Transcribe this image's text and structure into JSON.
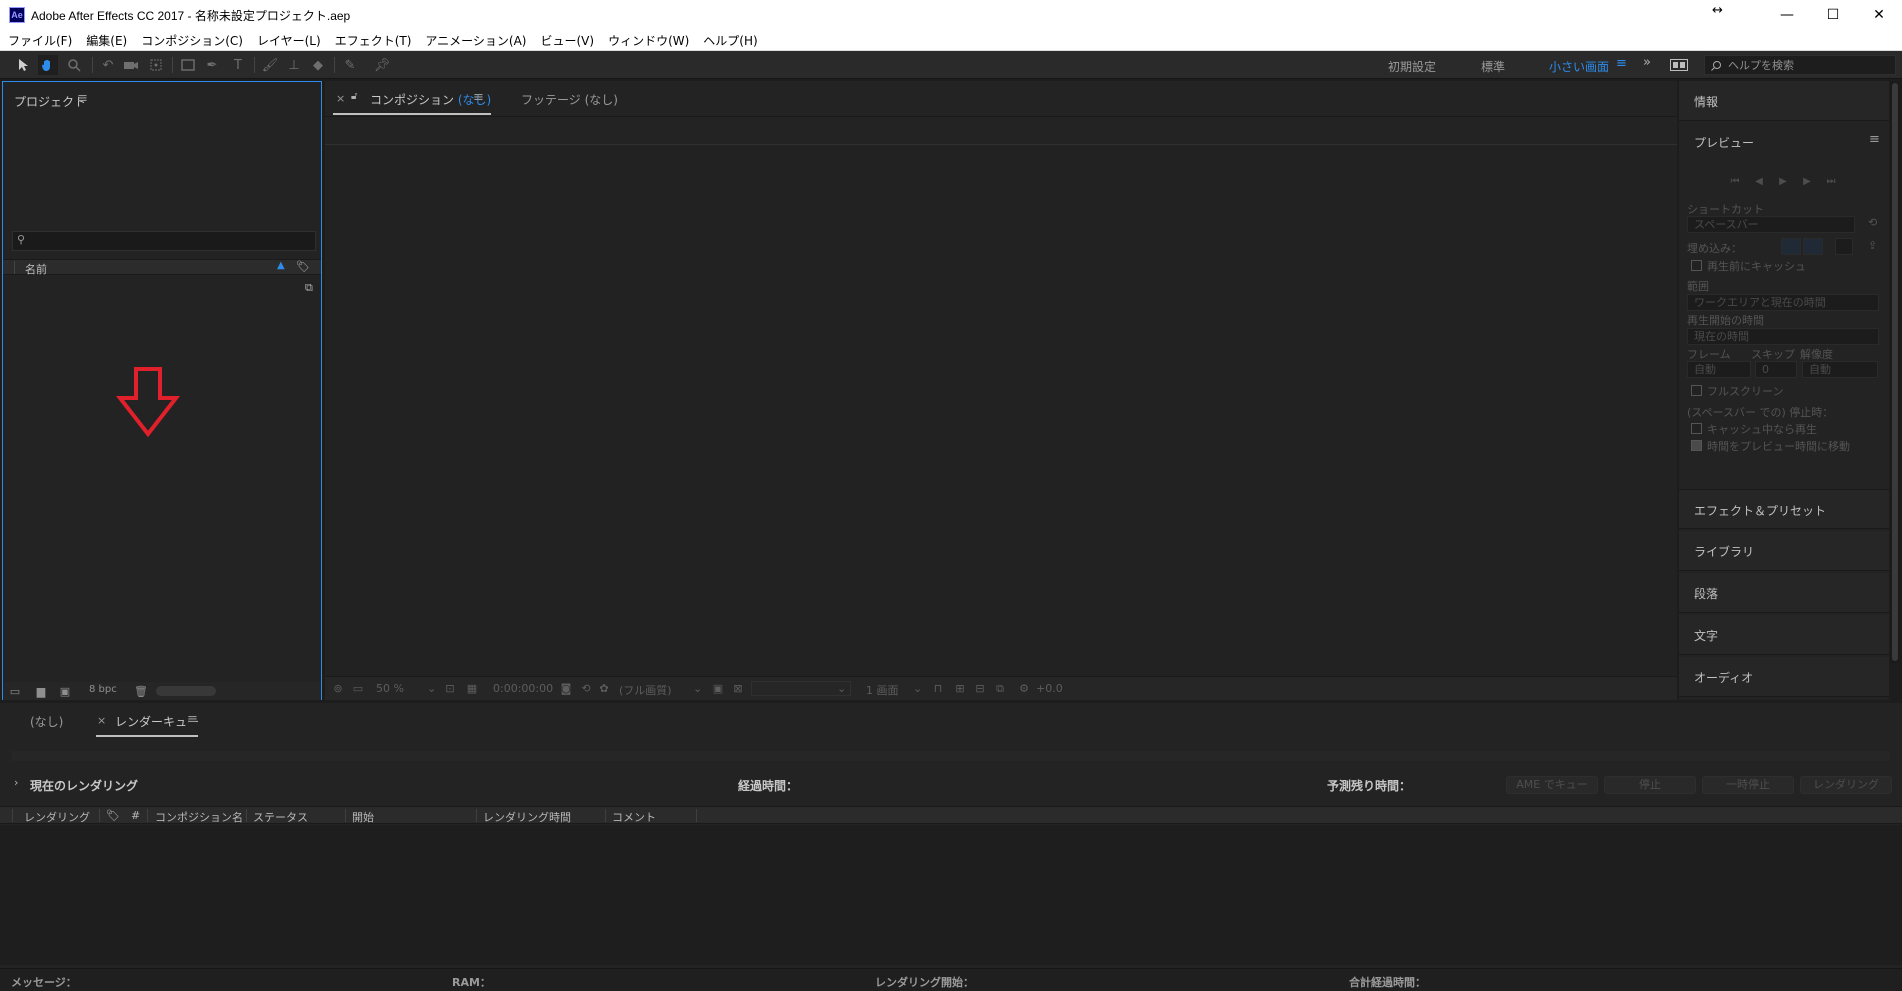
{
  "window": {
    "app_icon": "Ae",
    "title": "Adobe After Effects CC 2017 - 名称未設定プロジェクト.aep",
    "resize_glyph": "↔",
    "minimize": "—",
    "maximize": "☐",
    "close": "✕"
  },
  "menu": [
    "ファイル(F)",
    "編集(E)",
    "コンポジション(C)",
    "レイヤー(L)",
    "エフェクト(T)",
    "アニメーション(A)",
    "ビュー(V)",
    "ウィンドウ(W)",
    "ヘルプ(H)"
  ],
  "toolbar": {
    "workspaces": [
      "初期設定",
      "標準",
      "小さい画面"
    ],
    "active_workspace": "小さい画面",
    "help_search_placeholder": "ヘルプを検索"
  },
  "project": {
    "title": "プロジェクト",
    "column_name": "名前",
    "bpc": "8 bpc"
  },
  "composition": {
    "tab_prefix": "コンポジション",
    "tab_name": "(なし)",
    "footage_tab": "フッテージ (なし)",
    "zoom": "50 %",
    "timecode": "0:00:00:00",
    "resolution": "(フル画質)",
    "view_count": "1 画面",
    "exposure": "+0.0"
  },
  "right_panel": {
    "info": "情報",
    "preview": "プレビュー",
    "shortcut_label": "ショートカット",
    "shortcut_value": "スペースバー",
    "include_label": "埋め込み：",
    "cache_before": "再生前にキャッシュ",
    "range_label": "範囲",
    "range_value": "ワークエリアと現在の時間",
    "start_label": "再生開始の時間",
    "start_value": "現在の時間",
    "frame_label": "フレーム",
    "skip_label": "スキップ",
    "resolution_label": "解像度",
    "frame_value": "自動",
    "skip_value": "0",
    "resolution_value": "自動",
    "fullscreen": "フルスクリーン",
    "stop_label": "(スペースバー での) 停止時：",
    "if_caching": "キャッシュ中なら再生",
    "move_time": "時間をプレビュー時間に移動",
    "effects": "エフェクト＆プリセット",
    "library": "ライブラリ",
    "paragraph": "段落",
    "character": "文字",
    "audio": "オーディオ"
  },
  "render_queue": {
    "tab_none": "(なし)",
    "tab_rq": "レンダーキュー",
    "current_render": "現在のレンダリング",
    "elapsed": "経過時間：",
    "remaining": "予測残り時間：",
    "buttons": [
      "AME でキュー",
      "停止",
      "一時停止",
      "レンダリング"
    ],
    "columns": [
      "レンダリング",
      "#",
      "コンポジション名",
      "ステータス",
      "開始",
      "レンダリング時間",
      "コメント"
    ],
    "footer": [
      "メッセージ：",
      "RAM：",
      "レンダリング開始：",
      "合計経過時間："
    ]
  },
  "colors": {
    "accent": "#2d8ceb",
    "arrow": "#e0202a"
  }
}
